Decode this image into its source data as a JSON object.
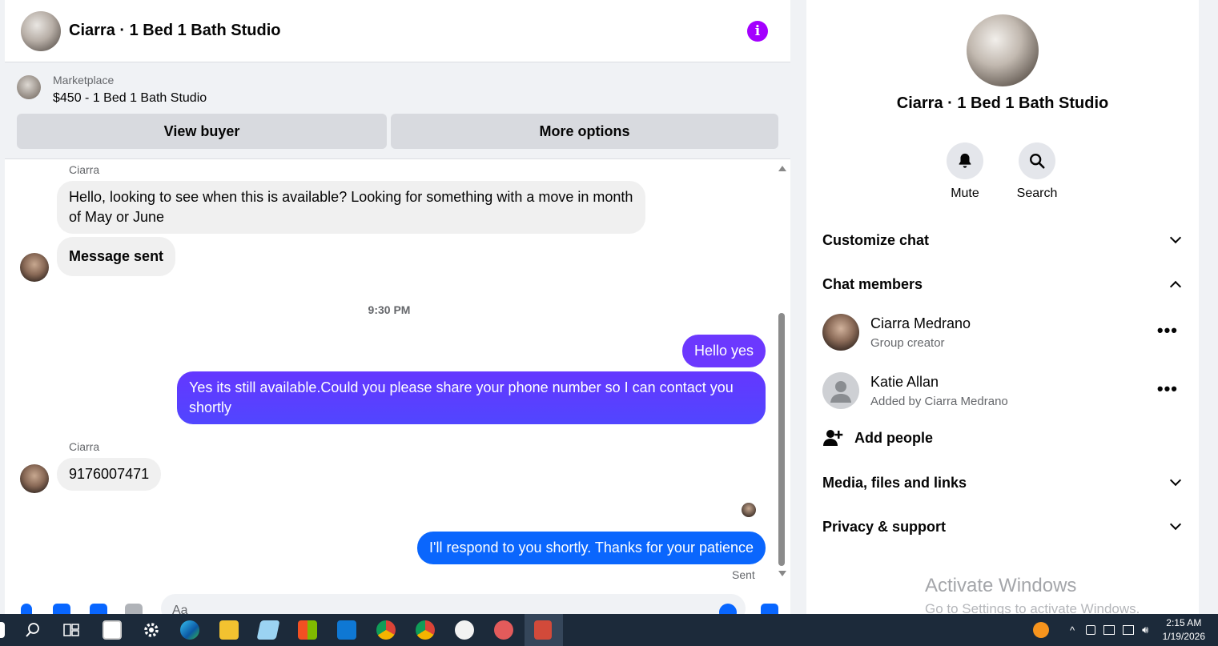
{
  "chat": {
    "title": "Ciarra · 1 Bed 1 Bath Studio",
    "marketplace": {
      "label": "Marketplace",
      "listing": "$450 - 1 Bed 1 Bath Studio",
      "view_buyer": "View buyer",
      "more_options": "More options"
    },
    "messages": {
      "sender1": "Ciarra",
      "msg1": "Hello, looking to see when this is available? Looking for something with a move in month of May or June",
      "msg2": "Message sent",
      "time": "9:30 PM",
      "out1": "Hello yes",
      "out2": "Yes its still available.Could you please share your phone number so I can contact you shortly",
      "sender2": "Ciarra",
      "msg3": "9176007471",
      "out3": "I'll respond to you shortly. Thanks for your patience",
      "status": "Sent"
    },
    "composer_placeholder": "Aa",
    "colors": {
      "outgoing_gradient_top": "#6a3bff",
      "outgoing_gradient_bottom": "#0866ff",
      "info": "#a400ff"
    }
  },
  "side": {
    "title": "Ciarra · 1 Bed 1 Bath Studio",
    "actions": {
      "mute": "Mute",
      "search": "Search"
    },
    "customize": "Customize chat",
    "members_header": "Chat members",
    "members": [
      {
        "name": "Ciarra Medrano",
        "role": "Group creator",
        "more": "•••"
      },
      {
        "name": "Katie Allan",
        "role": "Added by Ciarra Medrano",
        "more": "•••"
      }
    ],
    "add_people": "Add people",
    "media": "Media, files and links",
    "privacy": "Privacy & support"
  },
  "watermark": {
    "line1": "Activate Windows",
    "line2": "Go to Settings to activate Windows."
  },
  "taskbar": {
    "time": "2:15 AM",
    "date": "1/19/2026"
  }
}
